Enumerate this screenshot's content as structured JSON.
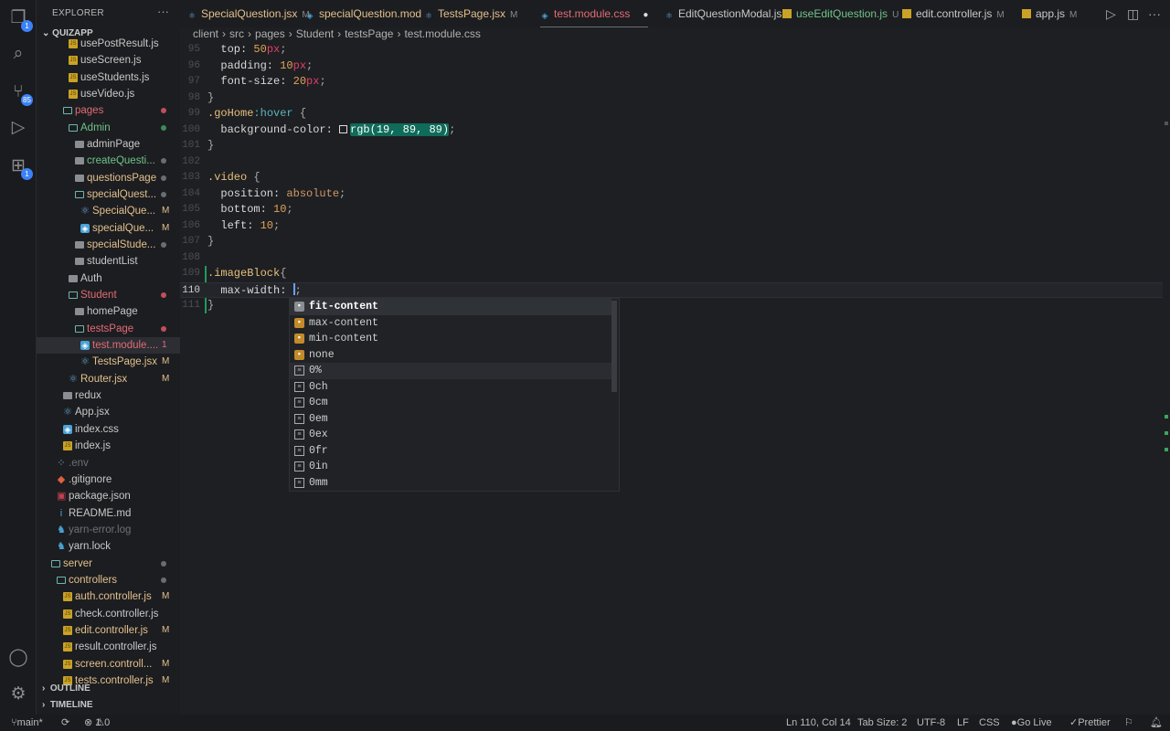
{
  "activity": [
    {
      "name": "explorer-icon",
      "glyph": "❐",
      "badge": "1"
    },
    {
      "name": "search-icon",
      "glyph": "⌕"
    },
    {
      "name": "source-control-icon",
      "glyph": "⑂",
      "badge": "85"
    },
    {
      "name": "run-debug-icon",
      "glyph": "▷"
    },
    {
      "name": "extensions-icon",
      "glyph": "⊞",
      "badge": "1"
    },
    {
      "name": "account-icon",
      "glyph": "◯"
    },
    {
      "name": "settings-gear-icon",
      "glyph": "⚙"
    }
  ],
  "sidebar": {
    "title": "EXPLORER",
    "more": "···",
    "project": "QUIZAPP",
    "outline": "OUTLINE",
    "timeline": "TIMELINE",
    "items": [
      {
        "label": "usePostResult.js",
        "icon": "js",
        "indent": 48,
        "color": "gray"
      },
      {
        "label": "useScreen.js",
        "icon": "js",
        "indent": 48,
        "color": "gray"
      },
      {
        "label": "useStudents.js",
        "icon": "js",
        "indent": 48,
        "color": "gray"
      },
      {
        "label": "useVideo.js",
        "icon": "js",
        "indent": 48,
        "color": "gray"
      },
      {
        "label": "pages",
        "icon": "fopen",
        "indent": 42,
        "color": "red",
        "dot": "#c0505a"
      },
      {
        "label": "Admin",
        "icon": "fopen",
        "indent": 48,
        "color": "green",
        "dot": "#3f8a5a"
      },
      {
        "label": "adminPage",
        "icon": "fclosed",
        "indent": 55,
        "color": "gray"
      },
      {
        "label": "createQuesti...",
        "icon": "fclosed",
        "indent": 55,
        "color": "green",
        "dot": "#6a6d72"
      },
      {
        "label": "questionsPage",
        "icon": "fclosed",
        "indent": 55,
        "color": "tan",
        "dot": "#6a6d72"
      },
      {
        "label": "specialQuest...",
        "icon": "fopen",
        "indent": 55,
        "color": "tan",
        "dot": "#6a6d72"
      },
      {
        "label": "SpecialQue...",
        "icon": "react",
        "indent": 61,
        "color": "tan",
        "status": "M"
      },
      {
        "label": "specialQue...",
        "icon": "css",
        "indent": 61,
        "color": "tan",
        "status": "M"
      },
      {
        "label": "specialStude...",
        "icon": "fclosed",
        "indent": 55,
        "color": "tan",
        "dot": "#6a6d72"
      },
      {
        "label": "studentList",
        "icon": "fclosed",
        "indent": 55,
        "color": "gray"
      },
      {
        "label": "Auth",
        "icon": "fclosed",
        "indent": 48,
        "color": "gray"
      },
      {
        "label": "Student",
        "icon": "fopen",
        "indent": 48,
        "color": "red",
        "dot": "#c0505a"
      },
      {
        "label": "homePage",
        "icon": "fclosed",
        "indent": 55,
        "color": "gray"
      },
      {
        "label": "testsPage",
        "icon": "fopen",
        "indent": 55,
        "color": "red",
        "dot": "#c0505a"
      },
      {
        "label": "test.module....",
        "icon": "css",
        "indent": 61,
        "color": "red",
        "status": "1",
        "selected": true
      },
      {
        "label": "TestsPage.jsx",
        "icon": "react",
        "indent": 61,
        "color": "tan",
        "status": "M"
      },
      {
        "label": "Router.jsx",
        "icon": "react",
        "indent": 48,
        "color": "tan",
        "status": "M"
      },
      {
        "label": "redux",
        "icon": "fclosed",
        "indent": 42,
        "color": "gray"
      },
      {
        "label": "App.jsx",
        "icon": "react",
        "indent": 42,
        "color": "gray"
      },
      {
        "label": "index.css",
        "icon": "css",
        "indent": 42,
        "color": "gray"
      },
      {
        "label": "index.js",
        "icon": "js",
        "indent": 42,
        "color": "gray"
      },
      {
        "label": ".env",
        "icon": "env",
        "indent": 35,
        "color": "dim"
      },
      {
        "label": ".gitignore",
        "icon": "git",
        "indent": 35,
        "color": "gray"
      },
      {
        "label": "package.json",
        "icon": "pkg",
        "indent": 35,
        "color": "gray"
      },
      {
        "label": "README.md",
        "icon": "info",
        "indent": 35,
        "color": "gray"
      },
      {
        "label": "yarn-error.log",
        "icon": "yarn",
        "indent": 35,
        "color": "dim"
      },
      {
        "label": "yarn.lock",
        "icon": "yarn",
        "indent": 35,
        "color": "gray"
      },
      {
        "label": "server",
        "icon": "fopen",
        "indent": 29,
        "color": "tan",
        "dot": "#6a6d72"
      },
      {
        "label": "controllers",
        "icon": "fopen",
        "indent": 35,
        "color": "tan",
        "dot": "#6a6d72"
      },
      {
        "label": "auth.controller.js",
        "icon": "js",
        "indent": 42,
        "color": "tan",
        "status": "M"
      },
      {
        "label": "check.controller.js",
        "icon": "js",
        "indent": 42,
        "color": "gray"
      },
      {
        "label": "edit.controller.js",
        "icon": "js",
        "indent": 42,
        "color": "tan",
        "status": "M"
      },
      {
        "label": "result.controller.js",
        "icon": "js",
        "indent": 42,
        "color": "gray"
      },
      {
        "label": "screen.controll...",
        "icon": "js",
        "indent": 42,
        "color": "tan",
        "status": "M"
      },
      {
        "label": "tests.controller.js",
        "icon": "js",
        "indent": 42,
        "color": "tan",
        "status": "M"
      }
    ]
  },
  "tabs": [
    {
      "label": "SpecialQuestion.jsx",
      "icon": "react",
      "mark": "M",
      "color": "tan"
    },
    {
      "label": "specialQuestion.mod",
      "icon": "css",
      "color": "tan"
    },
    {
      "label": "TestsPage.jsx",
      "icon": "react",
      "mark": "M",
      "color": "tan"
    },
    {
      "label": "test.module.css",
      "icon": "css",
      "mark": "●",
      "color": "red",
      "active": true
    },
    {
      "label": "EditQuestionModal.js",
      "icon": "react",
      "color": "gray"
    },
    {
      "label": "useEditQuestion.js",
      "icon": "js",
      "mark": "U",
      "color": "green"
    },
    {
      "label": "edit.controller.js",
      "icon": "js",
      "mark": "M",
      "color": "gray"
    },
    {
      "label": "app.js",
      "icon": "js",
      "mark": "M",
      "color": "gray"
    }
  ],
  "tab_actions": {
    "run": "▷",
    "split": "◫",
    "more": "···"
  },
  "breadcrumb": [
    "client",
    "src",
    "pages",
    "Student",
    "testsPage",
    "test.module.css"
  ],
  "code": [
    {
      "n": "95",
      "t": [
        [
          "  top: ",
          "prop"
        ],
        [
          "50",
          "num"
        ],
        [
          "px",
          "unit"
        ],
        [
          ";",
          "pun"
        ]
      ]
    },
    {
      "n": "96",
      "t": [
        [
          "  padding: ",
          "prop"
        ],
        [
          "10",
          "num"
        ],
        [
          "px",
          "unit"
        ],
        [
          ";",
          "pun"
        ]
      ]
    },
    {
      "n": "97",
      "t": [
        [
          "  font-size: ",
          "prop"
        ],
        [
          "20",
          "num"
        ],
        [
          "px",
          "unit"
        ],
        [
          ";",
          "pun"
        ]
      ]
    },
    {
      "n": "98",
      "t": [
        [
          "}",
          "pun"
        ]
      ]
    },
    {
      "n": "99",
      "t": [
        [
          ".goHome",
          "sel"
        ],
        [
          ":hover",
          "pseudo"
        ],
        [
          " {",
          "pun"
        ]
      ]
    },
    {
      "n": "100",
      "t": [
        [
          "  background-color: ",
          "prop"
        ],
        [
          "",
          "swatch"
        ],
        [
          "rgb(19, 89, 89)",
          "hl"
        ],
        [
          ";",
          "pun"
        ]
      ]
    },
    {
      "n": "101",
      "t": [
        [
          "}",
          "pun"
        ]
      ]
    },
    {
      "n": "102",
      "t": []
    },
    {
      "n": "103",
      "t": [
        [
          ".video",
          "sel"
        ],
        [
          " {",
          "pun"
        ]
      ]
    },
    {
      "n": "104",
      "t": [
        [
          "  position: ",
          "prop"
        ],
        [
          "absolute",
          "kw"
        ],
        [
          ";",
          "pun"
        ]
      ]
    },
    {
      "n": "105",
      "t": [
        [
          "  bottom: ",
          "prop"
        ],
        [
          "10",
          "num"
        ],
        [
          ";",
          "pun"
        ]
      ]
    },
    {
      "n": "106",
      "t": [
        [
          "  left: ",
          "prop"
        ],
        [
          "10",
          "num"
        ],
        [
          ";",
          "pun"
        ]
      ]
    },
    {
      "n": "107",
      "t": [
        [
          "}",
          "pun"
        ]
      ]
    },
    {
      "n": "108",
      "t": []
    },
    {
      "n": "109",
      "t": [
        [
          ".imageBlock",
          "sel"
        ],
        [
          "{",
          "pun"
        ]
      ]
    },
    {
      "n": "110",
      "t": [
        [
          "  max-width: ",
          "prop"
        ],
        [
          ";",
          "pun"
        ]
      ],
      "current": true
    },
    {
      "n": "111",
      "t": [
        [
          "}",
          "pun"
        ]
      ]
    }
  ],
  "suggestions": [
    {
      "label": "fit-content",
      "kind": "valw",
      "focused": true
    },
    {
      "label": "max-content",
      "kind": "val"
    },
    {
      "label": "min-content",
      "kind": "val"
    },
    {
      "label": "none",
      "kind": "val"
    },
    {
      "label": "0%",
      "kind": "unit",
      "hover": true
    },
    {
      "label": "0ch",
      "kind": "unit"
    },
    {
      "label": "0cm",
      "kind": "unit"
    },
    {
      "label": "0em",
      "kind": "unit"
    },
    {
      "label": "0ex",
      "kind": "unit"
    },
    {
      "label": "0fr",
      "kind": "unit"
    },
    {
      "label": "0in",
      "kind": "unit"
    },
    {
      "label": "0mm",
      "kind": "unit"
    }
  ],
  "status": {
    "branch": "main*",
    "sync": "⟳",
    "errors": "1",
    "warnings": "0",
    "position": "Ln 110, Col 14",
    "tab_size": "Tab Size: 2",
    "encoding": "UTF-8",
    "eol": "LF",
    "language": "CSS",
    "go_live": "Go Live",
    "prettier": "Prettier"
  }
}
